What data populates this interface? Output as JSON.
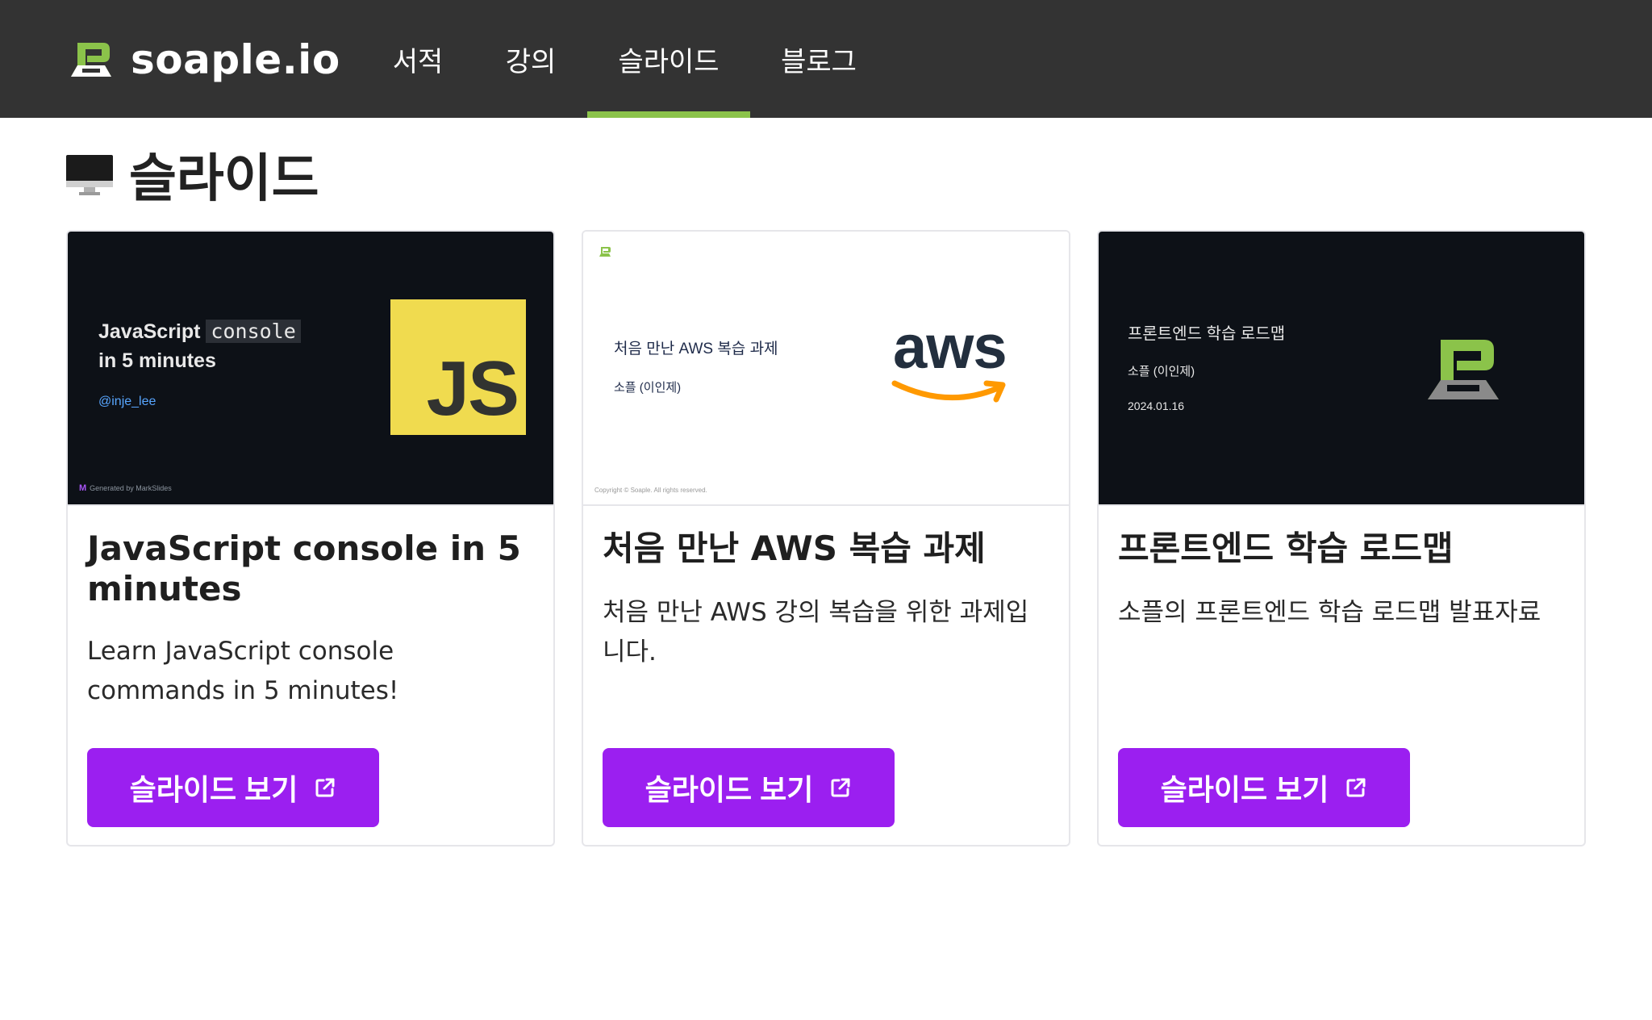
{
  "header": {
    "brand": "soaple.io",
    "nav": [
      {
        "label": "서적",
        "active": false
      },
      {
        "label": "강의",
        "active": false
      },
      {
        "label": "슬라이드",
        "active": true
      },
      {
        "label": "블로그",
        "active": false
      }
    ]
  },
  "page": {
    "title": "슬라이드",
    "icon": "desktop-computer-icon"
  },
  "cards": [
    {
      "thumb": {
        "title_prefix": "JavaScript",
        "title_code": "console",
        "title_line2": "in 5 minutes",
        "handle": "@inje_lee",
        "badge": "JS",
        "footer": "Generated by MarkSlides",
        "footer_mark": "M"
      },
      "title": "JavaScript console in 5 minutes",
      "description": "Learn JavaScript console commands in 5 minutes!",
      "button": "슬라이드 보기"
    },
    {
      "thumb": {
        "title": "처음 만난 AWS 복습 과제",
        "author": "소플 (이인제)",
        "brand_word": "aws",
        "footer": "Copyright © Soaple. All rights reserved."
      },
      "title": "처음 만난 AWS 복습 과제",
      "description": "처음 만난 AWS 강의 복습을 위한 과제입니다.",
      "button": "슬라이드 보기"
    },
    {
      "thumb": {
        "title": "프론트엔드 학습 로드맵",
        "author": "소플 (이인제)",
        "date": "2024.01.16"
      },
      "title": "프론트엔드 학습 로드맵",
      "description": "소플의 프론트엔드 학습 로드맵 발표자료",
      "button": "슬라이드 보기"
    }
  ],
  "colors": {
    "header_bg": "#333333",
    "nav_active_underline": "#8bc34a",
    "button_bg": "#9b1ff0",
    "brand_green": "#8bc34a"
  }
}
